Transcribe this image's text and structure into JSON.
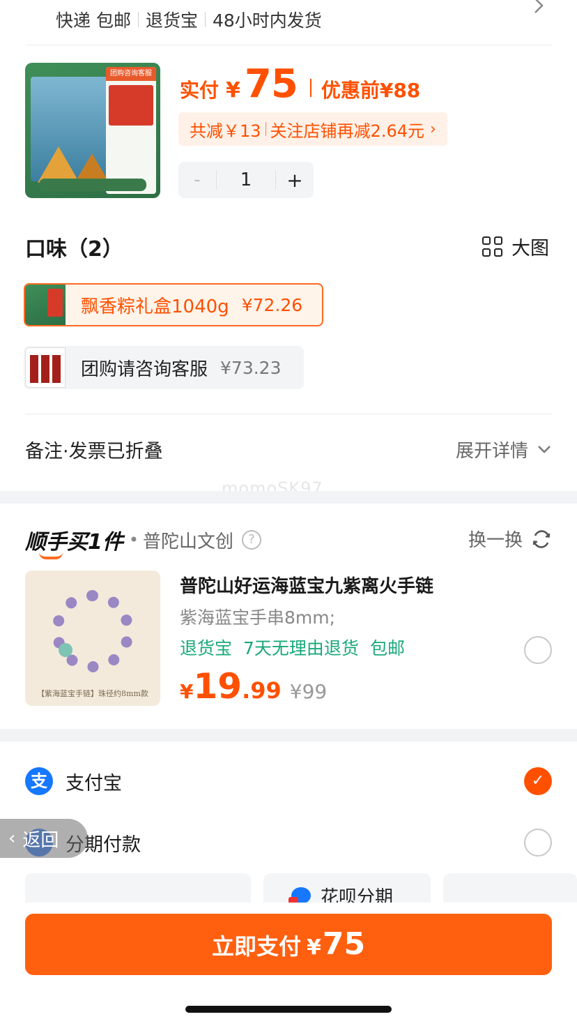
{
  "shipping": {
    "tags": [
      "快递 包邮",
      "退货宝",
      "48小时内发货"
    ]
  },
  "product": {
    "pay_label": "实付",
    "currency": "¥",
    "pay_amount": "75",
    "before_label": "优惠前",
    "before_amount": "¥88",
    "discount_text_1": "共减￥13",
    "discount_text_2": "关注店铺再减2.64元",
    "discount_arrow": "›",
    "quantity": "1",
    "minus": "-",
    "plus": "+",
    "image_text": "团购咨询客服"
  },
  "flavor": {
    "title": "口味（2）",
    "big_image_label": "大图",
    "options": [
      {
        "label": "飘香粽礼盒1040g",
        "price": "¥72.26",
        "selected": true
      },
      {
        "label": "团购请咨询客服",
        "price": "¥73.23",
        "selected": false
      }
    ]
  },
  "remark": {
    "label": "备注·发票已折叠",
    "expand_label": "展开详情"
  },
  "watermark": "momoSK97",
  "addon": {
    "logo": "顺手买1件",
    "dot": "•",
    "store": "普陀山文创",
    "help": "?",
    "swap_label": "换一换",
    "title": "普陀山好运海蓝宝九紫离火手链",
    "spec": "紫海蓝宝手串8mm;",
    "tags": [
      "退货宝",
      "7天无理由退货",
      "包邮"
    ],
    "price_yen": "¥",
    "price_int": "19",
    "price_dec": ".99",
    "original_price": "¥99",
    "image_caption": "【紫海蓝宝手链】珠径约8mm款"
  },
  "payment": {
    "alipay_label": "支付宝",
    "alipay_icon": "支",
    "installment_label": "分期付款",
    "huabei_label": "花呗分期",
    "check_mark": "✓"
  },
  "back_button": {
    "label": "返回",
    "chevron": "‹"
  },
  "pay_button": {
    "label": "立即支付",
    "yen": "¥",
    "amount": "75"
  },
  "colors": {
    "accent": "#ff5000",
    "green_tag": "#19a87a",
    "alipay_blue": "#1677ff"
  }
}
